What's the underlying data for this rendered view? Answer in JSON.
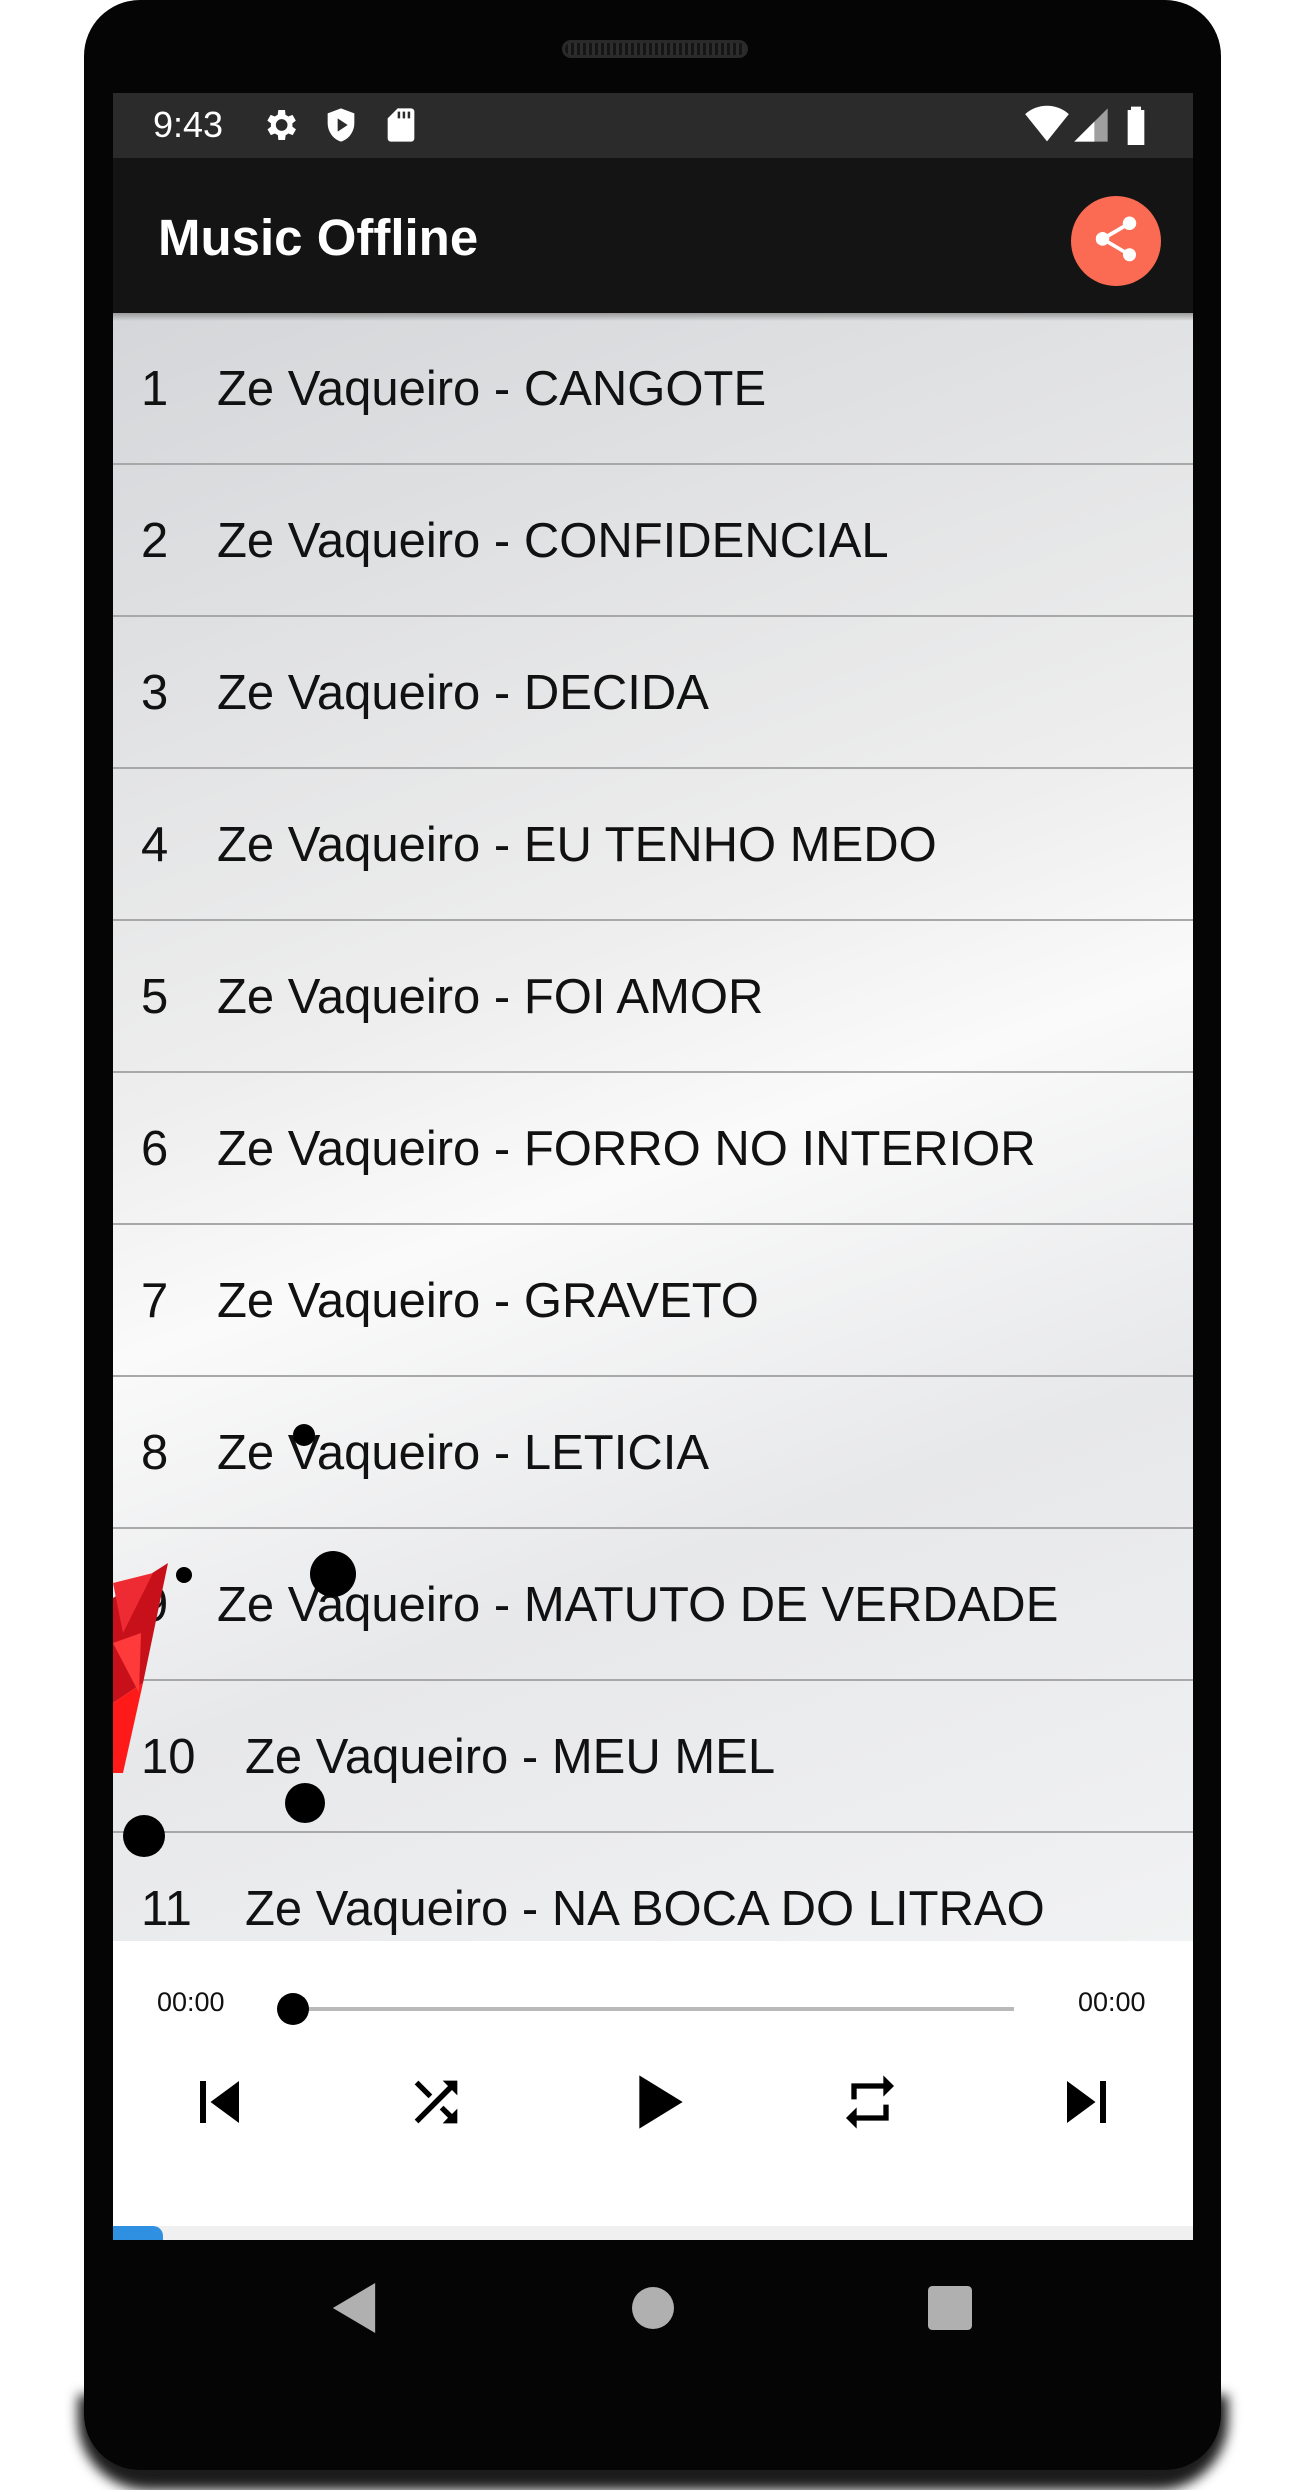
{
  "status_bar": {
    "time": "9:43",
    "left_icons": [
      "gear-icon",
      "shield-play-icon",
      "sd-card-icon"
    ],
    "right_icons": [
      "wifi-icon",
      "cell-signal-icon",
      "battery-icon"
    ]
  },
  "app_bar": {
    "title": "Music Offline",
    "share_icon": "share-icon",
    "share_color": "#fb6a53"
  },
  "songs": [
    {
      "num": "1",
      "title": "Ze Vaqueiro - CANGOTE"
    },
    {
      "num": "2",
      "title": "Ze Vaqueiro - CONFIDENCIAL"
    },
    {
      "num": "3",
      "title": "Ze Vaqueiro - DECIDA"
    },
    {
      "num": "4",
      "title": "Ze Vaqueiro - EU TENHO MEDO"
    },
    {
      "num": "5",
      "title": "Ze Vaqueiro - FOI AMOR"
    },
    {
      "num": "6",
      "title": "Ze Vaqueiro - FORRO NO INTERIOR"
    },
    {
      "num": "7",
      "title": "Ze Vaqueiro - GRAVETO"
    },
    {
      "num": "8",
      "title": "Ze Vaqueiro - LETICIA"
    },
    {
      "num": "9",
      "title": "Ze Vaqueiro - MATUTO DE VERDADE"
    },
    {
      "num": "10",
      "title": "Ze Vaqueiro - MEU MEL"
    },
    {
      "num": "11",
      "title": "Ze Vaqueiro - NA BOCA DO LITRAO"
    }
  ],
  "player": {
    "elapsed": "00:00",
    "duration": "00:00",
    "progress": 0,
    "controls": [
      "skip-previous-icon",
      "shuffle-icon",
      "play-icon",
      "repeat-icon",
      "skip-next-icon"
    ]
  },
  "nav_bar": {
    "buttons": [
      "back-icon",
      "home-icon",
      "recents-icon"
    ]
  }
}
